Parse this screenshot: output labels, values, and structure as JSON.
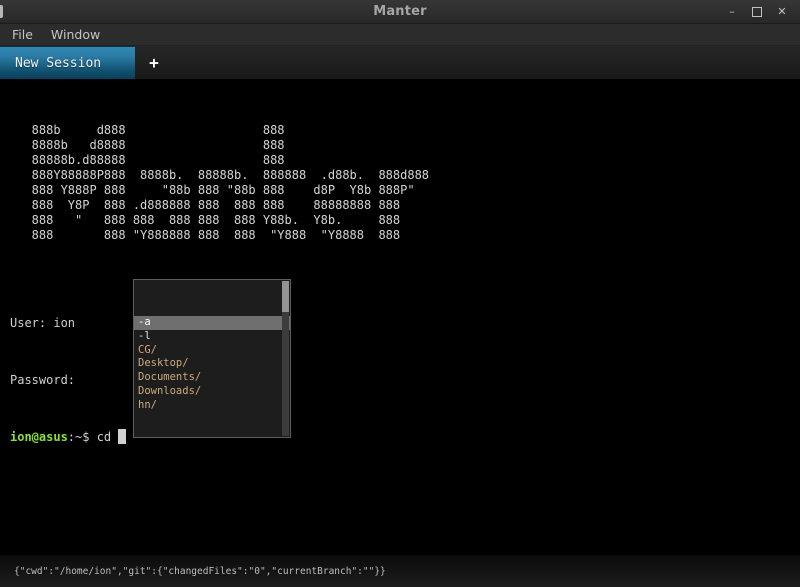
{
  "window": {
    "title": "Manter",
    "controls": {
      "minimize": "–",
      "close": "✕"
    }
  },
  "menu": {
    "items": [
      {
        "label": "File"
      },
      {
        "label": "Window"
      }
    ]
  },
  "tabs": {
    "active_label": "New Session",
    "new_tab_label": "+"
  },
  "terminal": {
    "banner_lines": [
      "   888b     d888                   888",
      "   8888b   d8888                   888",
      "   88888b.d88888                   888",
      "   888Y88888P888  8888b.  88888b.  888888  .d88b.  888d888",
      "   888 Y888P 888     \"88b 888 \"88b 888    d8P  Y8b 888P\"",
      "   888  Y8P  888 .d888888 888  888 888    88888888 888",
      "   888   \"   888 888  888 888  888 Y88b.  Y8b.     888",
      "   888       888 \"Y888888 888  888  \"Y888  \"Y8888  888"
    ],
    "lines": [
      "User: ion",
      "Password:"
    ],
    "prompt": {
      "user_host": "ion@asus",
      "rest": ":~$ ",
      "command": "cd "
    },
    "colors": {
      "background": "#000000",
      "foreground": "#d0d0d0",
      "prompt_green": "#8ae234",
      "cursor": "#cfcfcf"
    }
  },
  "autocomplete": {
    "items": [
      {
        "label": "-a",
        "type": "flag",
        "selected": true
      },
      {
        "label": "-l",
        "type": "flag",
        "selected": false
      },
      {
        "label": "CG/",
        "type": "dir",
        "selected": false
      },
      {
        "label": "Desktop/",
        "type": "dir",
        "selected": false
      },
      {
        "label": "Documents/",
        "type": "dir",
        "selected": false
      },
      {
        "label": "Downloads/",
        "type": "dir",
        "selected": false
      },
      {
        "label": "hn/",
        "type": "dir",
        "selected": false
      }
    ],
    "colors": {
      "directory_text": "#ccaa7a",
      "flag_text": "#e2e2e2",
      "selected_background": "#6f6f6f"
    }
  },
  "status_bar": {
    "text": "{\"cwd\":\"/home/ion\",\"git\":{\"changedFiles\":\"0\",\"currentBranch\":\"\"}}"
  },
  "theme": {
    "tab_active_top": "#3288b2",
    "tab_active_bottom": "#0b3f5a",
    "chrome_background": "#2c2c2c"
  }
}
